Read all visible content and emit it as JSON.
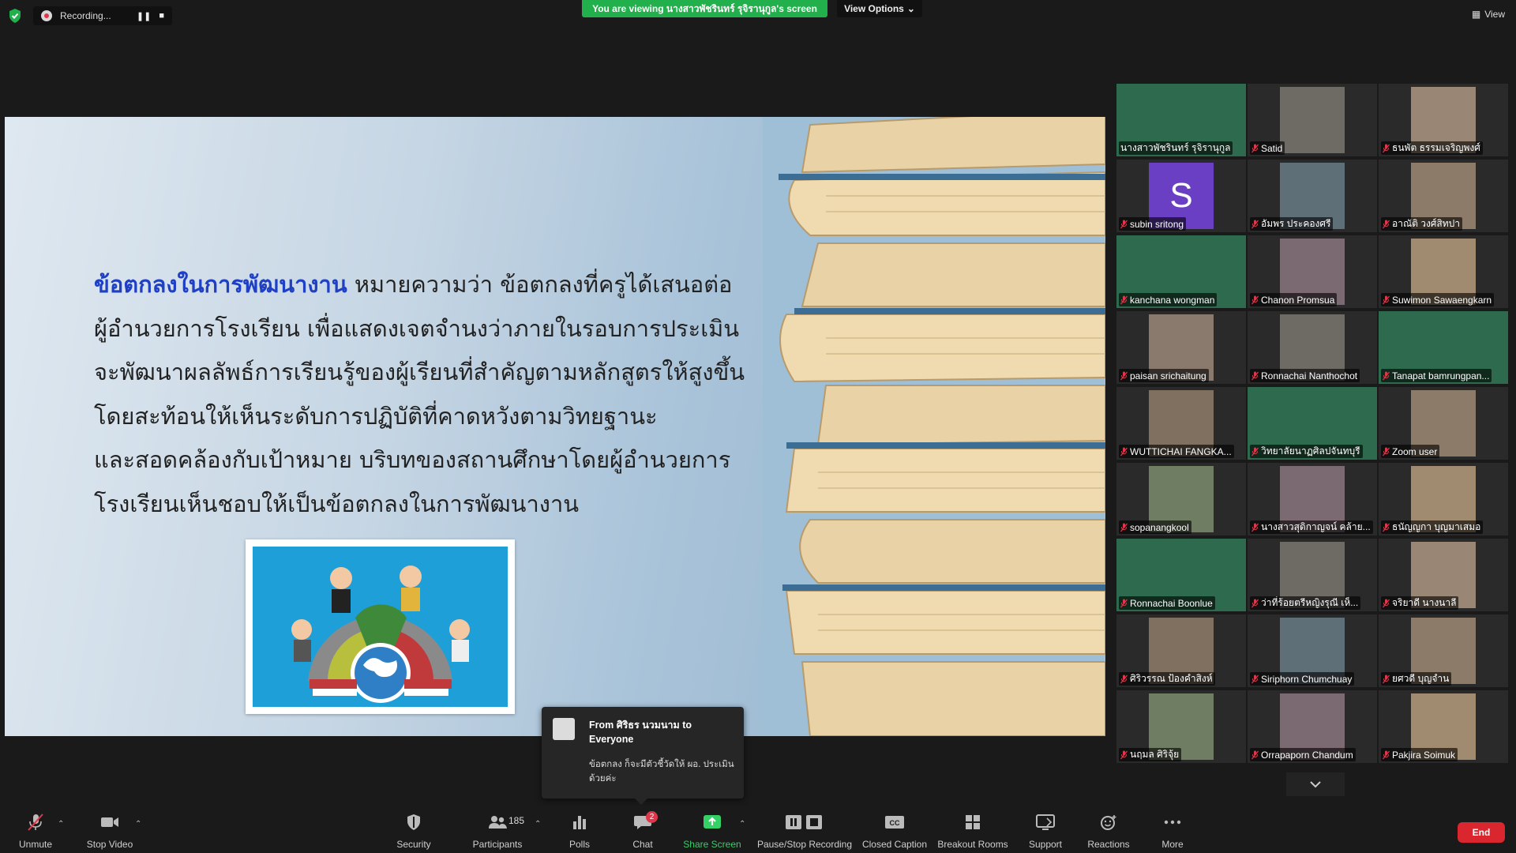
{
  "top_bar": {
    "recording_label": "Recording...",
    "viewing_banner": "You are viewing นางสาวพัชรินทร์ รุจิรานุกูล's screen",
    "view_options_label": "View Options",
    "view_label": "View"
  },
  "slide": {
    "highlight": "ข้อตกลงในการพัฒนางาน",
    "line1_rest": " หมายความว่า ข้อตกลงที่ครูได้เสนอต่อ",
    "line2": "ผู้อำนวยการโรงเรียน เพื่อแสดงเจตจำนงว่าภายในรอบการประเมิน",
    "line3": "จะพัฒนาผลลัพธ์การเรียนรู้ของผู้เรียนที่สำคัญตามหลักสูตรให้สูงขึ้น",
    "line4": "โดยสะท้อนให้เห็นระดับการปฏิบัติที่คาดหวังตามวิทยฐานะ",
    "line5": "และสอดคล้องกับเป้าหมาย บริบทของสถานศึกษาโดยผู้อำนวยการ",
    "line6": "โรงเรียนเห็นชอบให้เป็นข้อตกลงในการพัฒนางาน"
  },
  "participants": [
    {
      "name": "นางสาวพัชรินทร์ รุจิรานุกูล",
      "active": true
    },
    {
      "name": "Satid"
    },
    {
      "name": "ธนพัต ธรรมเจริญพงศ์"
    },
    {
      "name": "subin sritong",
      "avatar_letter": "S"
    },
    {
      "name": "อัมพร ประคองศรี"
    },
    {
      "name": "อาณัติ วงศ์สิทปา"
    },
    {
      "name": "kanchana wongman"
    },
    {
      "name": "Chanon Promsua"
    },
    {
      "name": "Suwimon Sawaengkarn"
    },
    {
      "name": "paisan srichaitung"
    },
    {
      "name": "Ronnachai Nanthochot"
    },
    {
      "name": "Tanapat bamrungpan..."
    },
    {
      "name": "WUTTICHAI FANGKA..."
    },
    {
      "name": "วิทยาลัยนาฏศิลปจันทบุรี"
    },
    {
      "name": "Zoom user"
    },
    {
      "name": "sopanangkool"
    },
    {
      "name": "นางสาวสุดิกาญจน์ คล้าย..."
    },
    {
      "name": "ธนัญญกา บุญมาเสมอ"
    },
    {
      "name": "Ronnachai Boonlue"
    },
    {
      "name": "ว่าที่ร้อยตรีหญิงรุณี เห็..."
    },
    {
      "name": "จริยาดี นางนาลี"
    },
    {
      "name": "ศิริวรรณ ป้องคำสิงห์"
    },
    {
      "name": "Siriphorn Chumchuay"
    },
    {
      "name": "ยศวดี บุญจำน"
    },
    {
      "name": "นฤมล ศิริจุ้ย"
    },
    {
      "name": "Orrapaporn Chandum"
    },
    {
      "name": "Pakjira Soimuk"
    }
  ],
  "chat_popup": {
    "from": "From ศิริธร นวมนาม to Everyone",
    "message": "ข้อตกลง ก็จะมีตัวชี้วัดให้ ผอ. ประเมินด้วยค่ะ"
  },
  "toolbar": {
    "unmute": "Unmute",
    "stop_video": "Stop Video",
    "security": "Security",
    "participants": "Participants",
    "participants_count": "185",
    "polls": "Polls",
    "chat": "Chat",
    "chat_badge": "2",
    "share_screen": "Share Screen",
    "pause_stop_recording": "Pause/Stop Recording",
    "closed_caption": "Closed Caption",
    "breakout_rooms": "Breakout Rooms",
    "support": "Support",
    "reactions": "Reactions",
    "more": "More",
    "end": "End"
  },
  "colors": {
    "banner_green": "#22b04c",
    "end_red": "#d9262f",
    "active_speaker_outline": "#9ed86a",
    "slide_highlight": "#1f3fc4",
    "share_green": "#35d066"
  }
}
